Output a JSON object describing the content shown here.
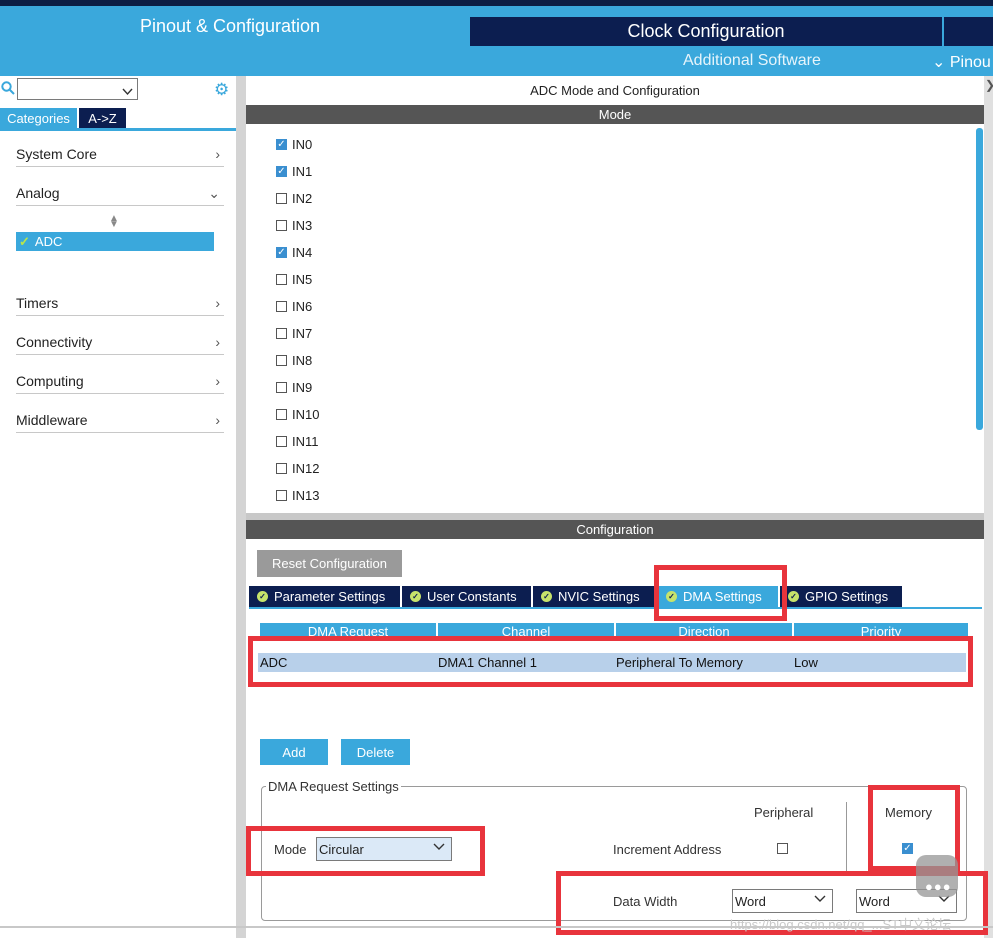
{
  "header": {
    "tabs": [
      "Pinout & Configuration",
      "Clock Configuration"
    ],
    "subtabs": [
      "Additional Software",
      "Pinou"
    ]
  },
  "left": {
    "category_tab": "Categories",
    "az_tab": "A->Z",
    "categories": [
      "System Core",
      "Analog",
      "Timers",
      "Connectivity",
      "Computing",
      "Middleware"
    ],
    "selected_item": "ADC"
  },
  "right": {
    "title": "ADC Mode and Configuration",
    "mode_header": "Mode",
    "channels": [
      {
        "label": "IN0",
        "checked": true
      },
      {
        "label": "IN1",
        "checked": true
      },
      {
        "label": "IN2",
        "checked": false
      },
      {
        "label": "IN3",
        "checked": false
      },
      {
        "label": "IN4",
        "checked": true
      },
      {
        "label": "IN5",
        "checked": false
      },
      {
        "label": "IN6",
        "checked": false
      },
      {
        "label": "IN7",
        "checked": false
      },
      {
        "label": "IN8",
        "checked": false
      },
      {
        "label": "IN9",
        "checked": false
      },
      {
        "label": "IN10",
        "checked": false
      },
      {
        "label": "IN11",
        "checked": false
      },
      {
        "label": "IN12",
        "checked": false
      },
      {
        "label": "IN13",
        "checked": false
      }
    ],
    "config_header": "Configuration",
    "reset_button": "Reset Configuration",
    "config_tabs": [
      "Parameter Settings",
      "User Constants",
      "NVIC Settings",
      "DMA Settings",
      "GPIO Settings"
    ],
    "active_tab": "DMA Settings",
    "dma_table": {
      "columns": [
        "DMA Request",
        "Channel",
        "Direction",
        "Priority"
      ],
      "rows": [
        [
          "ADC",
          "DMA1 Channel 1",
          "Peripheral To Memory",
          "Low"
        ]
      ]
    },
    "add_button": "Add",
    "delete_button": "Delete",
    "request_settings": {
      "legend": "DMA Request Settings",
      "mode_label": "Mode",
      "mode_value": "Circular",
      "peripheral_label": "Peripheral",
      "memory_label": "Memory",
      "increment_label": "Increment Address",
      "peripheral_increment": false,
      "memory_increment": true,
      "data_width_label": "Data Width",
      "peripheral_width": "Word",
      "memory_width": "Word"
    },
    "watermark": "https://blog.csdn.net/qq_...ST中文论坛"
  },
  "colors": {
    "accent": "#3aa8dc",
    "navy": "#0c1e50",
    "highlight_red": "#e8343c"
  }
}
